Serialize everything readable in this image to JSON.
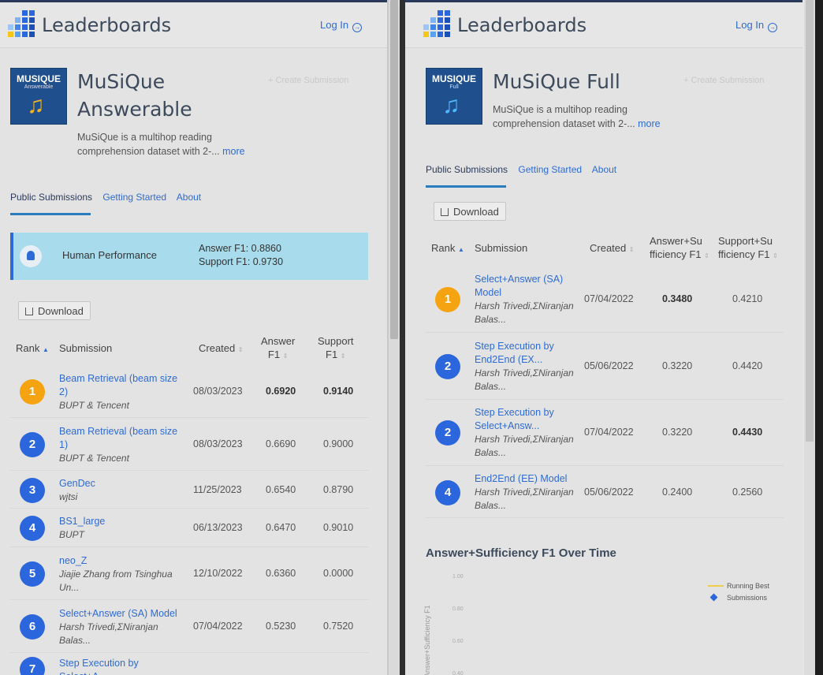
{
  "app": {
    "name": "Leaderboards",
    "login": "Log In",
    "create_submission": "+ Create Submission"
  },
  "left": {
    "thumb_title": "MUSIQUE",
    "thumb_sub": "Answerable",
    "title_line1": "MuSiQue",
    "title_line2": "Answerable",
    "desc_line1": "MuSiQue is a multihop reading",
    "desc_line2": "comprehension dataset with 2-...",
    "more": "more",
    "tabs": [
      "Public Submissions",
      "Getting Started",
      "About"
    ],
    "human": {
      "label": "Human Performance",
      "answer": "Answer F1: 0.8860",
      "support": "Support F1: 0.9730"
    },
    "download": "Download",
    "columns": {
      "rank": "Rank",
      "submission": "Submission",
      "created": "Created",
      "col4a": "Answer",
      "col4b": "F1",
      "col5a": "Support",
      "col5b": "F1"
    },
    "rows": [
      {
        "rank": "1",
        "title1": "Beam Retrieval (beam size",
        "title2": "2)",
        "author": "BUPT & Tencent",
        "author2": "",
        "created": "08/03/2023",
        "a": "0.6920",
        "s": "0.9140"
      },
      {
        "rank": "2",
        "title1": "Beam Retrieval (beam size",
        "title2": "1)",
        "author": "BUPT & Tencent",
        "author2": "",
        "created": "08/03/2023",
        "a": "0.6690",
        "s": "0.9000"
      },
      {
        "rank": "3",
        "title1": "GenDec",
        "title2": "",
        "author": "wjtsi",
        "author2": "",
        "created": "11/25/2023",
        "a": "0.6540",
        "s": "0.8790"
      },
      {
        "rank": "4",
        "title1": "BS1_large",
        "title2": "",
        "author": "BUPT",
        "author2": "",
        "created": "06/13/2023",
        "a": "0.6470",
        "s": "0.9010"
      },
      {
        "rank": "5",
        "title1": "neo_Z",
        "title2": "",
        "author": "Jiajie Zhang from Tsinghua",
        "author2": "Un...",
        "created": "12/10/2022",
        "a": "0.6360",
        "s": "0.0000"
      },
      {
        "rank": "6",
        "title1": "Select+Answer (SA) Model",
        "title2": "",
        "author": "Harsh Trivedi,ΣNiranjan",
        "author2": "Balas...",
        "created": "07/04/2022",
        "a": "0.5230",
        "s": "0.7520"
      },
      {
        "rank": "7",
        "title1": "Step Execution by",
        "title2": "Select+A...",
        "author": "",
        "author2": "",
        "created": "",
        "a": "",
        "s": ""
      }
    ]
  },
  "right": {
    "thumb_title": "MUSIQUE",
    "thumb_sub": "Full",
    "title": "MuSiQue Full",
    "desc_line1": "MuSiQue is a multihop reading",
    "desc_line2": "comprehension dataset with 2-...",
    "more": "more",
    "tabs": [
      "Public Submissions",
      "Getting Started",
      "About"
    ],
    "download": "Download",
    "columns": {
      "rank": "Rank",
      "submission": "Submission",
      "created": "Created",
      "col4a": "Answer+Su",
      "col4b": "fficiency F1",
      "col5a": "Support+Su",
      "col5b": "fficiency F1"
    },
    "rows": [
      {
        "rank": "1",
        "title1": "Select+Answer (SA)",
        "title2": "Model",
        "author": "Harsh Trivedi,ΣNiranjan",
        "author2": "Balas...",
        "created": "07/04/2022",
        "a": "0.3480",
        "s": "0.4210"
      },
      {
        "rank": "2",
        "title1": "Step Execution by",
        "title2": "End2End (EX...",
        "author": "Harsh Trivedi,ΣNiranjan",
        "author2": "Balas...",
        "created": "05/06/2022",
        "a": "0.3220",
        "s": "0.4420"
      },
      {
        "rank": "2",
        "title1": "Step Execution by",
        "title2": "Select+Answ...",
        "author": "Harsh Trivedi,ΣNiranjan",
        "author2": "Balas...",
        "created": "07/04/2022",
        "a": "0.3220",
        "s": "0.4430"
      },
      {
        "rank": "4",
        "title1": "End2End (EE) Model",
        "title2": "",
        "author": "Harsh Trivedi,ΣNiranjan",
        "author2": "Balas...",
        "created": "05/06/2022",
        "a": "0.2400",
        "s": "0.2560"
      }
    ],
    "chart_title": "Answer+Sufficiency F1 Over Time"
  },
  "chart_data": {
    "type": "scatter",
    "title": "Answer+Sufficiency F1 Over Time",
    "ylabel": "Answer+Sufficiency F1",
    "yticks": [
      "1.00",
      "0.80",
      "0.60",
      "0.40"
    ],
    "legend": [
      "Running Best",
      "Submissions"
    ],
    "legend_placement": "top-right",
    "series": []
  },
  "colors": {
    "accent": "#2f6bd6",
    "gold": "#f5a310",
    "rank_blue": "#2c66dd",
    "human_bg": "#a8dcec"
  }
}
